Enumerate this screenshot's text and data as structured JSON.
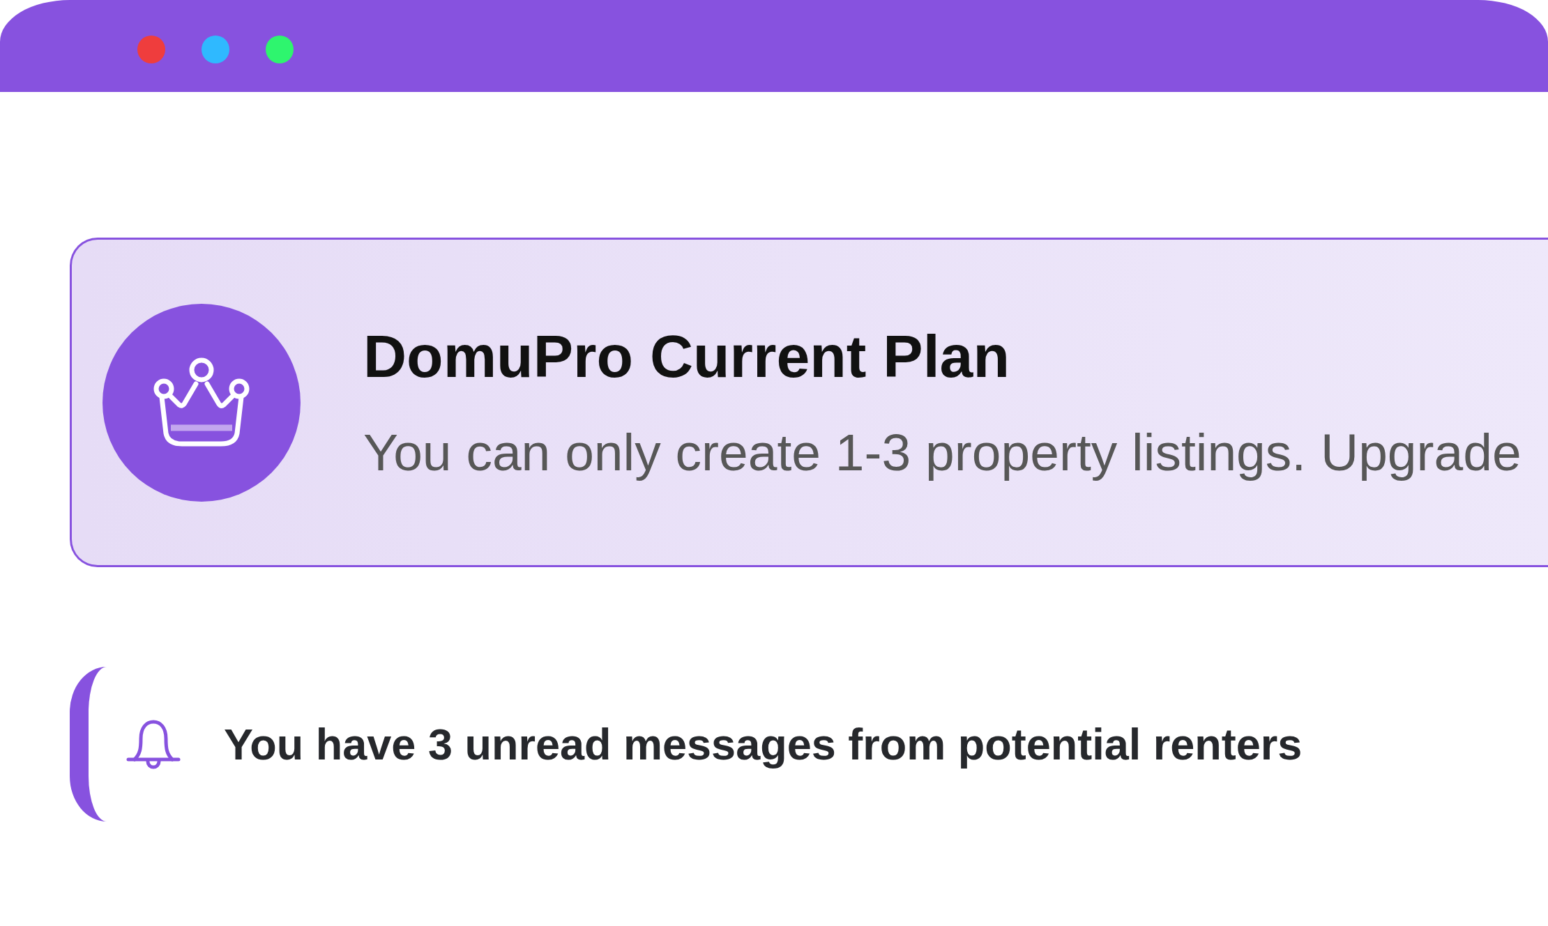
{
  "window": {
    "controls": [
      {
        "color": "#ef3d3d"
      },
      {
        "color": "#2fb9ff"
      },
      {
        "color": "#2ef56e"
      }
    ]
  },
  "plan_card": {
    "title": "DomuPro Current Plan",
    "description": "You can only create 1-3 property listings. Upgrade"
  },
  "notification": {
    "message": "You have 3 unread messages from potential renters"
  }
}
